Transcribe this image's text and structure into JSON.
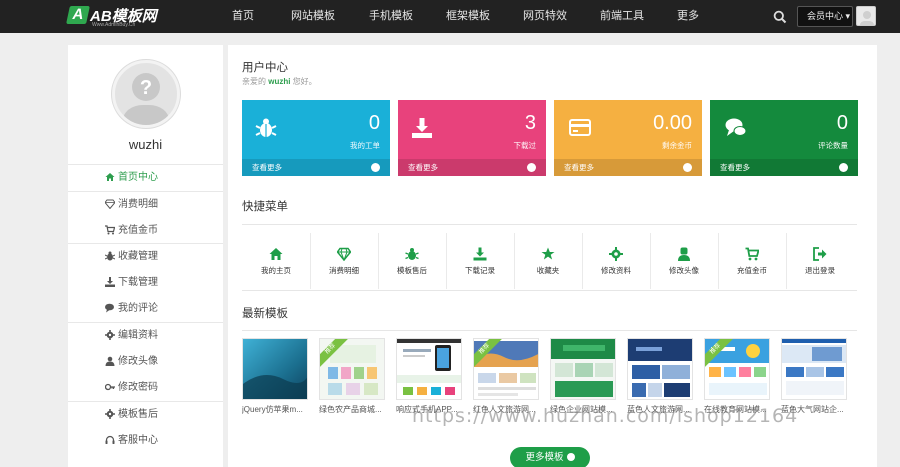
{
  "brand": {
    "logo_mark": "A",
    "name": "AB模板网",
    "sub": "Www.AdminBuy.Cn"
  },
  "nav": [
    "首页",
    "网站模板",
    "手机模板",
    "框架模板",
    "网页特效",
    "前端工具",
    "更多"
  ],
  "header": {
    "member_label": "会员中心 ▾"
  },
  "profile": {
    "username": "wuzhi"
  },
  "sidebar": {
    "items": [
      {
        "label": "首页中心",
        "icon": "home-icon"
      },
      {
        "label": "消费明细",
        "icon": "diamond-icon"
      },
      {
        "label": "充值金币",
        "icon": "cart-icon"
      },
      {
        "label": "收藏管理",
        "icon": "bug-icon"
      },
      {
        "label": "下载管理",
        "icon": "download-icon"
      },
      {
        "label": "我的评论",
        "icon": "comments-icon"
      },
      {
        "label": "编辑资料",
        "icon": "gear-icon"
      },
      {
        "label": "修改头像",
        "icon": "user-icon"
      },
      {
        "label": "修改密码",
        "icon": "key-icon"
      },
      {
        "label": "模板售后",
        "icon": "settings-icon"
      },
      {
        "label": "客服中心",
        "icon": "headset-icon"
      }
    ]
  },
  "user_center": {
    "title": "用户中心",
    "welcome_prefix": "亲爱的",
    "welcome_name": "wuzhi",
    "welcome_suffix": "您好。"
  },
  "stats": [
    {
      "value": "0",
      "caption": "我的工单",
      "more": "查看更多",
      "color": "#1ab0d8",
      "icon": "bug-icon"
    },
    {
      "value": "3",
      "caption": "下载过",
      "more": "查看更多",
      "color": "#e8427c",
      "icon": "download-icon"
    },
    {
      "value": "0.00",
      "caption": "剩余金币",
      "more": "查看更多",
      "color": "#f5b041",
      "icon": "credit-card-icon"
    },
    {
      "value": "0",
      "caption": "评论数量",
      "more": "查看更多",
      "color": "#148a3d",
      "icon": "comments-icon"
    }
  ],
  "quick_menu": {
    "title": "快捷菜单",
    "items": [
      {
        "label": "我的主页",
        "icon": "home-icon"
      },
      {
        "label": "消费明细",
        "icon": "diamond-icon"
      },
      {
        "label": "模板售后",
        "icon": "bug-icon"
      },
      {
        "label": "下载记录",
        "icon": "download-icon"
      },
      {
        "label": "收藏夹",
        "icon": "star-icon"
      },
      {
        "label": "修改资料",
        "icon": "gear-icon"
      },
      {
        "label": "修改头像",
        "icon": "user-icon"
      },
      {
        "label": "充值金币",
        "icon": "cart-icon"
      },
      {
        "label": "退出登录",
        "icon": "logout-icon"
      }
    ],
    "accent": "#1e9e48"
  },
  "latest": {
    "title": "最新模板",
    "ribbon": "推荐",
    "items": [
      {
        "label": "jQuery仿苹果m..."
      },
      {
        "label": "绿色农产品商城..."
      },
      {
        "label": "响应式手机APP..."
      },
      {
        "label": "红色人文旅游网..."
      },
      {
        "label": "绿色企业网站模..."
      },
      {
        "label": "蓝色人文旅游网..."
      },
      {
        "label": "在线教育网站模..."
      },
      {
        "label": "蓝色大气网站企..."
      }
    ]
  },
  "more_button": "更多模板",
  "watermark": "https://www.huzhan.com/ishop12164"
}
